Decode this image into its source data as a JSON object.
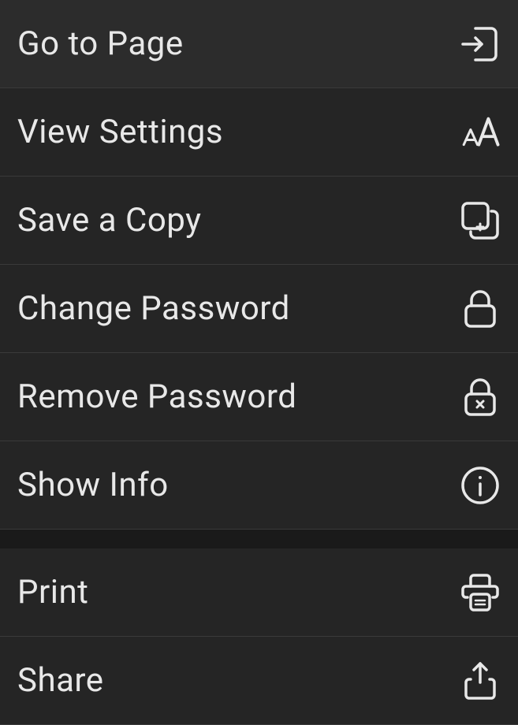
{
  "menu": {
    "items": [
      {
        "label": "Go to Page",
        "icon": "goto-page-icon"
      },
      {
        "label": "View Settings",
        "icon": "text-size-icon"
      },
      {
        "label": "Save a Copy",
        "icon": "copy-plus-icon"
      },
      {
        "label": "Change Password",
        "icon": "lock-icon"
      },
      {
        "label": "Remove Password",
        "icon": "lock-remove-icon"
      },
      {
        "label": "Show Info",
        "icon": "info-icon"
      },
      {
        "label": "Print",
        "icon": "printer-icon"
      },
      {
        "label": "Share",
        "icon": "share-icon"
      }
    ]
  }
}
